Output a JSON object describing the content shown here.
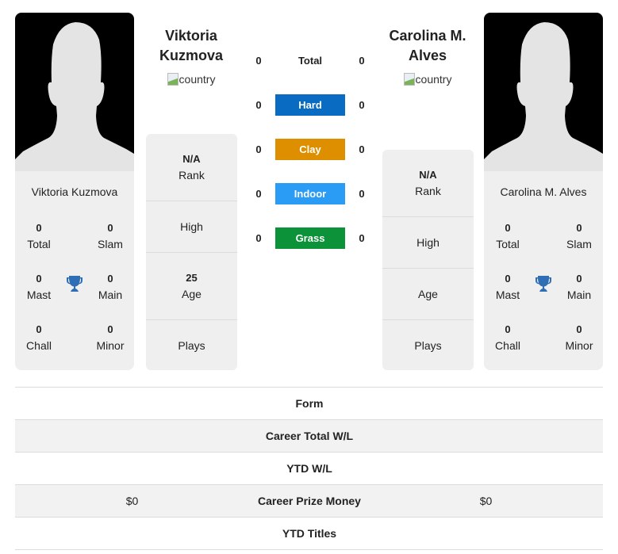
{
  "player_left": {
    "name": "Viktoria Kuzmova",
    "heading_line1": "Viktoria",
    "heading_line2": "Kuzmova",
    "country_alt": "country",
    "titles": {
      "total": {
        "value": "0",
        "label": "Total"
      },
      "slam": {
        "value": "0",
        "label": "Slam"
      },
      "mast": {
        "value": "0",
        "label": "Mast"
      },
      "main": {
        "value": "0",
        "label": "Main"
      },
      "chall": {
        "value": "0",
        "label": "Chall"
      },
      "minor": {
        "value": "0",
        "label": "Minor"
      }
    },
    "info": {
      "rank_value": "N/A",
      "rank_label": "Rank",
      "high_label": "High",
      "age_value": "25",
      "age_label": "Age",
      "plays_label": "Plays"
    }
  },
  "player_right": {
    "name": "Carolina M. Alves",
    "heading_line1": "Carolina M.",
    "heading_line2": "Alves",
    "country_alt": "country",
    "titles": {
      "total": {
        "value": "0",
        "label": "Total"
      },
      "slam": {
        "value": "0",
        "label": "Slam"
      },
      "mast": {
        "value": "0",
        "label": "Mast"
      },
      "main": {
        "value": "0",
        "label": "Main"
      },
      "chall": {
        "value": "0",
        "label": "Chall"
      },
      "minor": {
        "value": "0",
        "label": "Minor"
      }
    },
    "info": {
      "rank_value": "N/A",
      "rank_label": "Rank",
      "high_label": "High",
      "age_label": "Age",
      "plays_label": "Plays"
    }
  },
  "surfaces": [
    {
      "label": "Total",
      "left": "0",
      "right": "0",
      "color": ""
    },
    {
      "label": "Hard",
      "left": "0",
      "right": "0",
      "color": "#0a6bc2"
    },
    {
      "label": "Clay",
      "left": "0",
      "right": "0",
      "color": "#de8f00"
    },
    {
      "label": "Indoor",
      "left": "0",
      "right": "0",
      "color": "#2a9cf5"
    },
    {
      "label": "Grass",
      "left": "0",
      "right": "0",
      "color": "#0c9238"
    }
  ],
  "stats": [
    {
      "label": "Form",
      "left": "",
      "right": ""
    },
    {
      "label": "Career Total W/L",
      "left": "",
      "right": ""
    },
    {
      "label": "YTD W/L",
      "left": "",
      "right": ""
    },
    {
      "label": "Career Prize Money",
      "left": "$0",
      "right": "$0"
    },
    {
      "label": "YTD Titles",
      "left": "",
      "right": ""
    }
  ],
  "colors": {
    "trophy": "#2f6db5",
    "card_bg": "#efefef"
  }
}
